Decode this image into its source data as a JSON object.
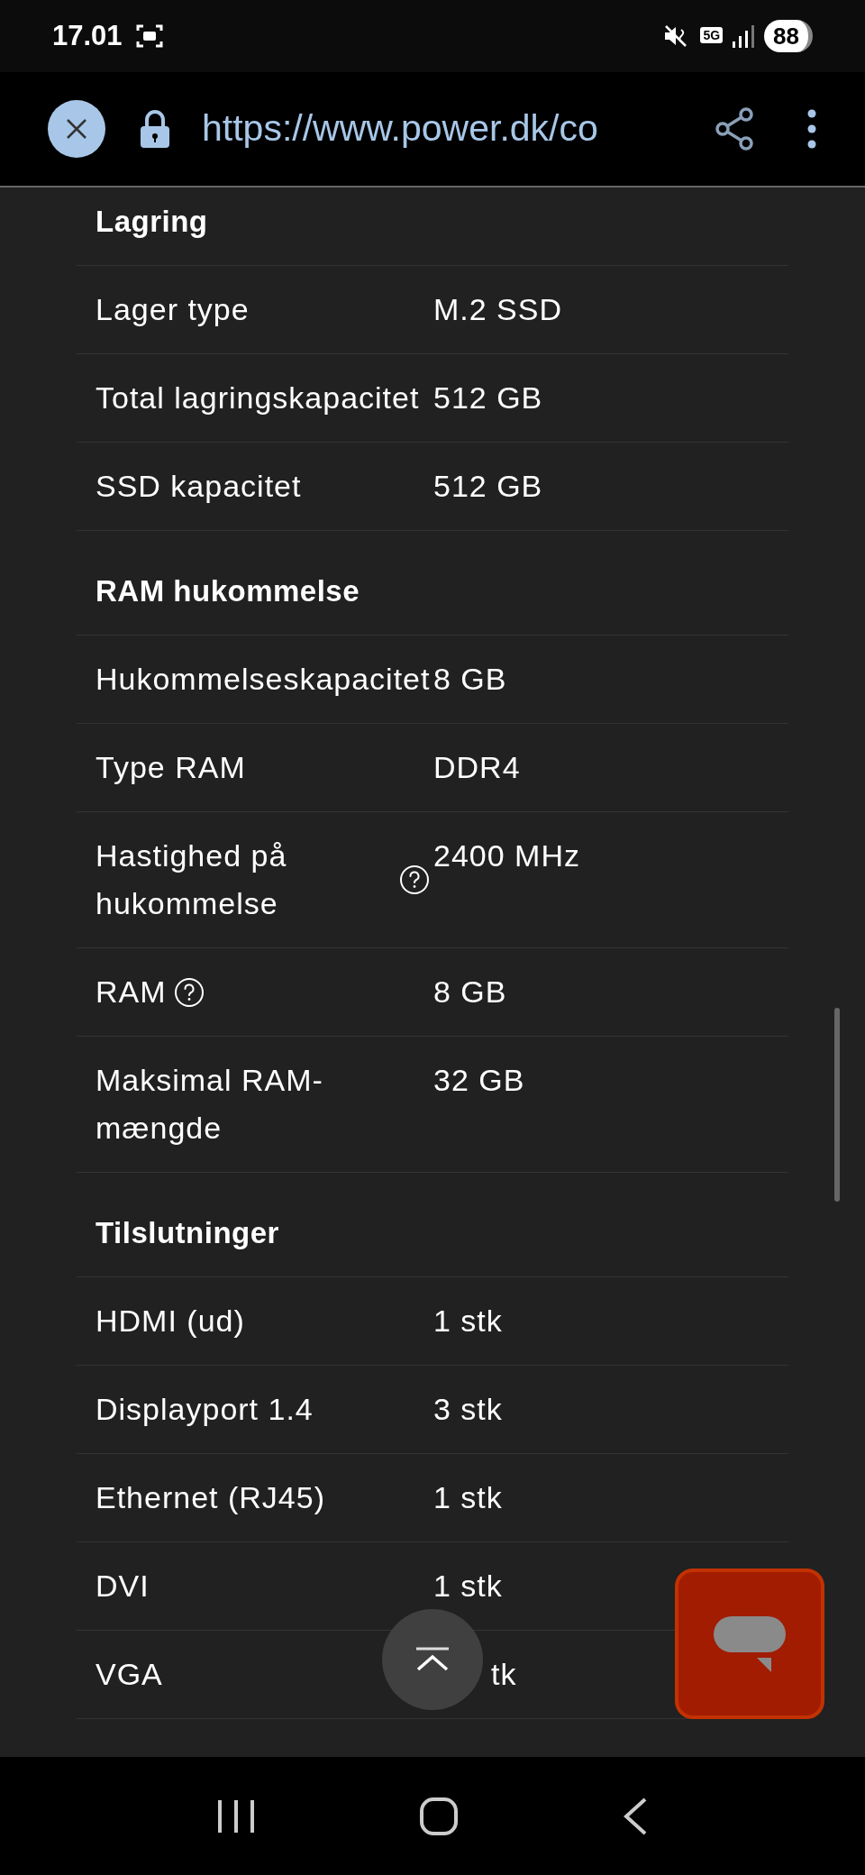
{
  "status_bar": {
    "time": "17.01",
    "network": "5G",
    "battery": "88"
  },
  "browser": {
    "url": "https://www.power.dk/co"
  },
  "sections": [
    {
      "heading": "Lagring",
      "rows": [
        {
          "label": "Lager type",
          "value": "M.2 SSD",
          "help": false
        },
        {
          "label": "Total lagringskapacitet",
          "value": "512 GB",
          "help": false
        },
        {
          "label": "SSD kapacitet",
          "value": "512 GB",
          "help": false
        }
      ]
    },
    {
      "heading": "RAM hukommelse",
      "rows": [
        {
          "label": "Hukommelseskapacitet",
          "value": "8 GB",
          "help": false
        },
        {
          "label": "Type RAM",
          "value": "DDR4",
          "help": false
        },
        {
          "label": "Hastighed på hukommelse",
          "value": "2400 MHz",
          "help": true
        },
        {
          "label": "RAM",
          "value": "8 GB",
          "help": true
        },
        {
          "label": "Maksimal RAM-mængde",
          "value": "32 GB",
          "help": false
        }
      ]
    },
    {
      "heading": "Tilslutninger",
      "rows": [
        {
          "label": "HDMI (ud)",
          "value": "1 stk",
          "help": false
        },
        {
          "label": "Displayport 1.4",
          "value": "3 stk",
          "help": false
        },
        {
          "label": "Ethernet (RJ45)",
          "value": "1 stk",
          "help": false
        },
        {
          "label": "DVI",
          "value": "1 stk",
          "help": false
        },
        {
          "label": "VGA",
          "value": "tk",
          "help": false,
          "covered": true
        }
      ]
    }
  ]
}
